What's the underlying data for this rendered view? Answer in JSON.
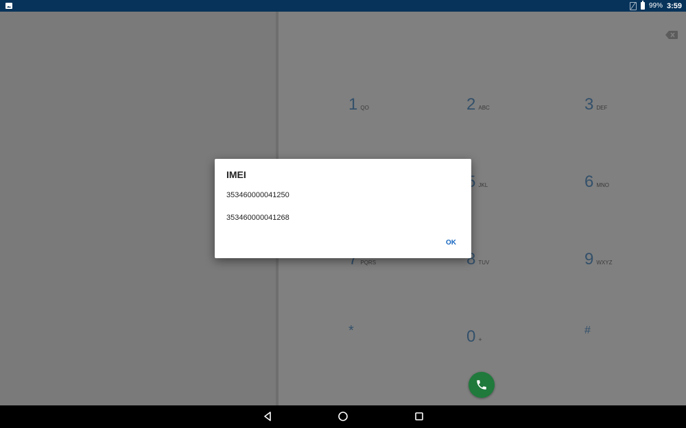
{
  "status_bar": {
    "battery_level": "99%",
    "time": "3:59",
    "icons": [
      "image-notification-icon",
      "no-sim-icon",
      "battery-icon"
    ]
  },
  "dialer": {
    "keys": [
      {
        "digit": "1",
        "letters": "QO"
      },
      {
        "digit": "2",
        "letters": "ABC"
      },
      {
        "digit": "3",
        "letters": "DEF"
      },
      {
        "digit": "5",
        "letters": "JKL"
      },
      {
        "digit": "6",
        "letters": "MNO"
      },
      {
        "digit": "7",
        "letters": "PQRS"
      },
      {
        "digit": "8",
        "letters": "TUV"
      },
      {
        "digit": "9",
        "letters": "WXYZ"
      },
      {
        "digit": "*",
        "letters": ""
      },
      {
        "digit": "0",
        "letters": "+"
      },
      {
        "digit": "#",
        "letters": ""
      }
    ],
    "call_button_color": "#1f7a3c"
  },
  "dialog": {
    "title": "IMEI",
    "imei_1": "353460000041250",
    "imei_2": "353460000041268",
    "ok_label": "OK",
    "accent_color": "#1565c0"
  },
  "nav_bar": {
    "icons": [
      "back-icon",
      "home-icon",
      "recents-icon"
    ]
  }
}
